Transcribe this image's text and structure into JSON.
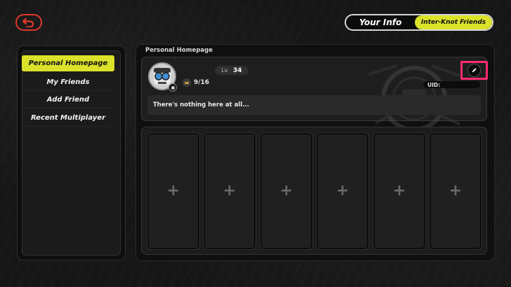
{
  "top_tabs": {
    "your_info": "Your Info",
    "inter_knot_friends": "Inter-Knot Friends"
  },
  "sidebar": {
    "items": [
      {
        "label": "Personal Homepage",
        "active": true
      },
      {
        "label": "My Friends",
        "active": false
      },
      {
        "label": "Add Friend",
        "active": false
      },
      {
        "label": "Recent Multiplayer",
        "active": false
      }
    ]
  },
  "main": {
    "section_title": "Personal Homepage",
    "profile": {
      "level_prefix": "Lv.",
      "level": "34",
      "badge_count": "9/16",
      "uid_label": "UID:",
      "bio": "There's nothing here at all..."
    },
    "showcase_slots": [
      "+",
      "+",
      "+",
      "+",
      "+",
      "+"
    ]
  },
  "icons": {
    "back": "back-arrow-icon",
    "edit": "pencil-icon",
    "badge": "medal-icon",
    "add": "plus-icon"
  },
  "colors": {
    "accent": "#dbe22a",
    "back": "#e0392b",
    "highlight": "#ff2b72"
  }
}
